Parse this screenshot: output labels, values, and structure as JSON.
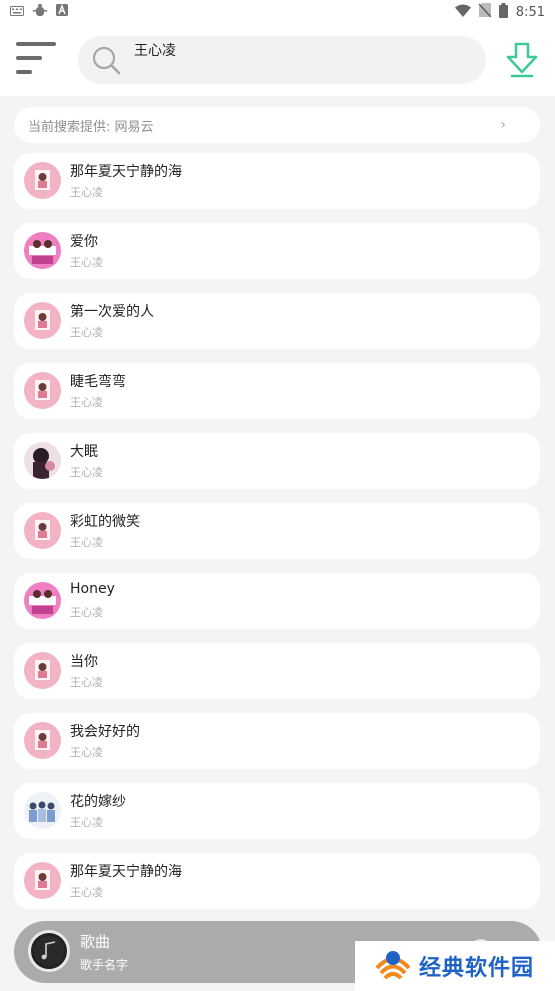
{
  "status_bar": {
    "left_icons": [
      "keyboard-icon",
      "bug-icon",
      "a-badge-icon"
    ],
    "right_icons": [
      "wifi-icon",
      "no-sim-icon",
      "battery-icon"
    ],
    "time": "8:51"
  },
  "header": {
    "search_text": "王心凌",
    "icons": {
      "menu": "menu-icon",
      "search": "search-icon",
      "download": "download-icon"
    },
    "accent_color": "#3ec99b"
  },
  "provider": {
    "label": "当前搜索提供: 网易云",
    "chevron": "›"
  },
  "songs": [
    {
      "title": "那年夏天宁静的海",
      "artist": "王心凌",
      "cover": "pink"
    },
    {
      "title": "爱你",
      "artist": "王心凌",
      "cover": "magenta"
    },
    {
      "title": "第一次爱的人",
      "artist": "王心凌",
      "cover": "pink"
    },
    {
      "title": "睫毛弯弯",
      "artist": "王心凌",
      "cover": "pink"
    },
    {
      "title": "大眠",
      "artist": "王心凌",
      "cover": "dark"
    },
    {
      "title": "彩虹的微笑",
      "artist": "王心凌",
      "cover": "pink"
    },
    {
      "title": "Honey",
      "artist": "王心凌",
      "cover": "magenta"
    },
    {
      "title": "当你",
      "artist": "王心凌",
      "cover": "pink"
    },
    {
      "title": "我会好好的",
      "artist": "王心凌",
      "cover": "pink"
    },
    {
      "title": "花的嫁纱",
      "artist": "王心凌",
      "cover": "group"
    },
    {
      "title": "那年夏天宁静的海",
      "artist": "王心凌",
      "cover": "pink"
    }
  ],
  "player": {
    "title": "歌曲",
    "artist": "歌手名字"
  },
  "watermark": {
    "text": "经典软件园"
  }
}
